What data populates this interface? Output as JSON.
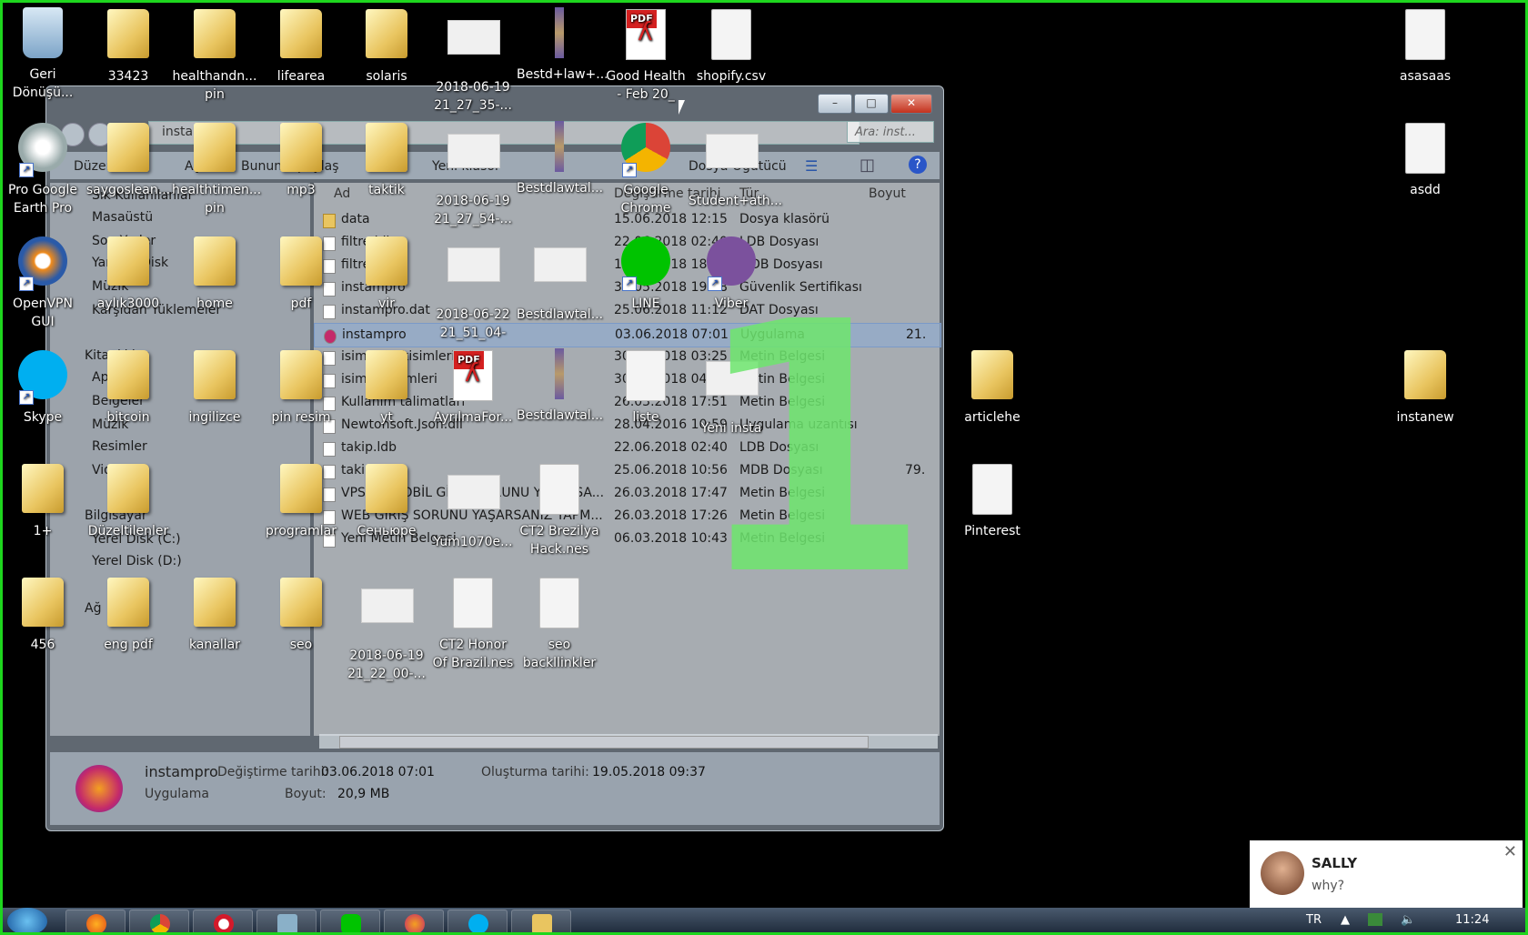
{
  "desktop_icons": [
    {
      "label": "Geri Dönüşü...",
      "type": "bin"
    },
    {
      "label": "33423",
      "type": "folder"
    },
    {
      "label": "healthandn... pin",
      "type": "folder"
    },
    {
      "label": "lifearea",
      "type": "folder"
    },
    {
      "label": "solaris",
      "type": "folder"
    },
    {
      "label": "2018-06-19 21_27_35-...",
      "type": "thumb"
    },
    {
      "label": "Bestd+law+...",
      "type": "strip"
    },
    {
      "label": "Good Health - Feb 20_",
      "type": "pdf"
    },
    {
      "label": "shopify.csv",
      "type": "doc"
    },
    {
      "label": "asasaas",
      "type": "doc"
    },
    {
      "label": "Pro Google Earth Pro",
      "type": "circle"
    },
    {
      "label": "saygoslean...",
      "type": "folder"
    },
    {
      "label": "healthtimen... pin",
      "type": "folder"
    },
    {
      "label": "mp3",
      "type": "folder"
    },
    {
      "label": "taktik",
      "type": "folder"
    },
    {
      "label": "2018-06-19 21_27_54-...",
      "type": "thumb"
    },
    {
      "label": "Bestdlawtal...",
      "type": "strip"
    },
    {
      "label": "Google Chrome",
      "type": "circle"
    },
    {
      "label": "Student+ath...",
      "type": "thumb"
    },
    {
      "label": "asdd",
      "type": "doc"
    },
    {
      "label": "OpenVPN GUI",
      "type": "circle"
    },
    {
      "label": "aylık3000",
      "type": "folder"
    },
    {
      "label": "home",
      "type": "folder"
    },
    {
      "label": "pdf",
      "type": "folder"
    },
    {
      "label": "vir",
      "type": "folder"
    },
    {
      "label": "2018-06-22 21_51_04-",
      "type": "thumb"
    },
    {
      "label": "Bestdlawtal...",
      "type": "thumb"
    },
    {
      "label": "LINE",
      "type": "circle"
    },
    {
      "label": "Viber",
      "type": "circle"
    },
    {
      "label": "Skype",
      "type": "circle"
    },
    {
      "label": "bitcoin",
      "type": "folder"
    },
    {
      "label": "ingilizce",
      "type": "folder"
    },
    {
      "label": "pin resim",
      "type": "folder"
    },
    {
      "label": "yt",
      "type": "folder"
    },
    {
      "label": "AyrılmaFor...",
      "type": "pdf"
    },
    {
      "label": "Bestdlawtal...",
      "type": "strip"
    },
    {
      "label": "liste",
      "type": "doc"
    },
    {
      "label": "Yeni insta",
      "type": "thumb"
    },
    {
      "label": "articlehe",
      "type": "folder"
    },
    {
      "label": "instanew",
      "type": "folder"
    },
    {
      "label": "1+",
      "type": "folder"
    },
    {
      "label": "Düzeltilenler",
      "type": "folder"
    },
    {
      "label": "programlar",
      "type": "folder"
    },
    {
      "label": "Сеньюре",
      "type": "folder"
    },
    {
      "label": "Yum1070e...",
      "type": "thumb"
    },
    {
      "label": "CT2 Brezilya Hack.nes",
      "type": "doc"
    },
    {
      "label": "Pinterest",
      "type": "doc"
    },
    {
      "label": "456",
      "type": "folder"
    },
    {
      "label": "eng pdf",
      "type": "folder"
    },
    {
      "label": "kanallar",
      "type": "folder"
    },
    {
      "label": "seo",
      "type": "folder"
    },
    {
      "label": "2018-06-19 21_22_00-...",
      "type": "thumb"
    },
    {
      "label": "CT2 Honor Of Brazil.nes",
      "type": "doc"
    },
    {
      "label": "seo backllinkler",
      "type": "doc"
    }
  ],
  "explorer": {
    "address": "instanew",
    "search_placeholder": "Ara: inst...",
    "toolbar": {
      "organize": "Düzenle",
      "open": "Aç",
      "share": "Bununla paylaş",
      "new_folder": "Yeni klasör",
      "burn": "Dosya Oğütücü"
    },
    "nav": [
      "Sık Kullanılanlar",
      "Masaüstü",
      "Son Yerler",
      "Yandex.Disk",
      "Müzik",
      "Karşıdan Yüklemeler",
      "Kitaplıklar",
      "Apps",
      "Belgeler",
      "Müzik",
      "Resimler",
      "Video",
      "Bilgisayar",
      "Yerel Disk (C:)",
      "Yerel Disk (D:)",
      "Ağ"
    ],
    "columns": {
      "name": "Ad",
      "modified": "Değiştirme tarihi",
      "type": "Tür",
      "size": "Boyut"
    },
    "files": [
      {
        "name": "data",
        "date": "15.06.2018 12:15",
        "type": "Dosya klasörü",
        "size": ""
      },
      {
        "name": "filtre.ldb",
        "date": "22.06.2018 02:40",
        "type": "LDB Dosyası",
        "size": ""
      },
      {
        "name": "filtre.mdb",
        "date": "18.05.2018 18:54",
        "type": "MDB Dosyası",
        "size": ""
      },
      {
        "name": "instampro",
        "date": "31.05.2018 19:38",
        "type": "Güvenlik Sertifikası",
        "size": ""
      },
      {
        "name": "instampro.dat",
        "date": "25.06.2018 11:12",
        "type": "DAT Dosyası",
        "size": ""
      },
      {
        "name": "instampro",
        "date": "03.06.2018 07:01",
        "type": "Uygulama",
        "size": "21."
      },
      {
        "name": "isim_erkekisimleri",
        "date": "30.01.2018 03:25",
        "type": "Metin Belgesi",
        "size": ""
      },
      {
        "name": "isim_kizisimleri",
        "date": "30.01.2018 04:23",
        "type": "Metin Belgesi",
        "size": ""
      },
      {
        "name": "Kullanım talimatları",
        "date": "26.03.2018 17:51",
        "type": "Metin Belgesi",
        "size": ""
      },
      {
        "name": "Newtonsoft.Json.dll",
        "date": "28.04.2016 10:59",
        "type": "Uygulama uzantısı",
        "size": ""
      },
      {
        "name": "takip.ldb",
        "date": "22.06.2018 02:40",
        "type": "LDB Dosyası",
        "size": ""
      },
      {
        "name": "takip.mdb",
        "date": "25.06.2018 10:56",
        "type": "MDB Dosyası",
        "size": "79."
      },
      {
        "name": "VPS DE MOBİL GİRİŞ SORUNU YAŞARSA...",
        "date": "26.03.2018 17:47",
        "type": "Metin Belgesi",
        "size": ""
      },
      {
        "name": "WEB GİRİŞ SORUNU YAŞARSANIZ YAPM...",
        "date": "26.03.2018 17:26",
        "type": "Metin Belgesi",
        "size": ""
      },
      {
        "name": "Yeni Metin Belgesi",
        "date": "06.03.2018 10:43",
        "type": "Metin Belgesi",
        "size": ""
      }
    ],
    "details": {
      "name": "instampro",
      "kind": "Uygulama",
      "modified_label": "Değiştirme tarihi:",
      "modified": "03.06.2018 07:01",
      "created_label": "Oluşturma tarihi:",
      "created": "19.05.2018 09:37",
      "size_label": "Boyut:",
      "size": "20,9 MB"
    }
  },
  "overlay_number": "1",
  "chat": {
    "name": "SALLY",
    "message": "why?"
  },
  "taskbar": {
    "lang": "TR",
    "time": "11:24"
  }
}
